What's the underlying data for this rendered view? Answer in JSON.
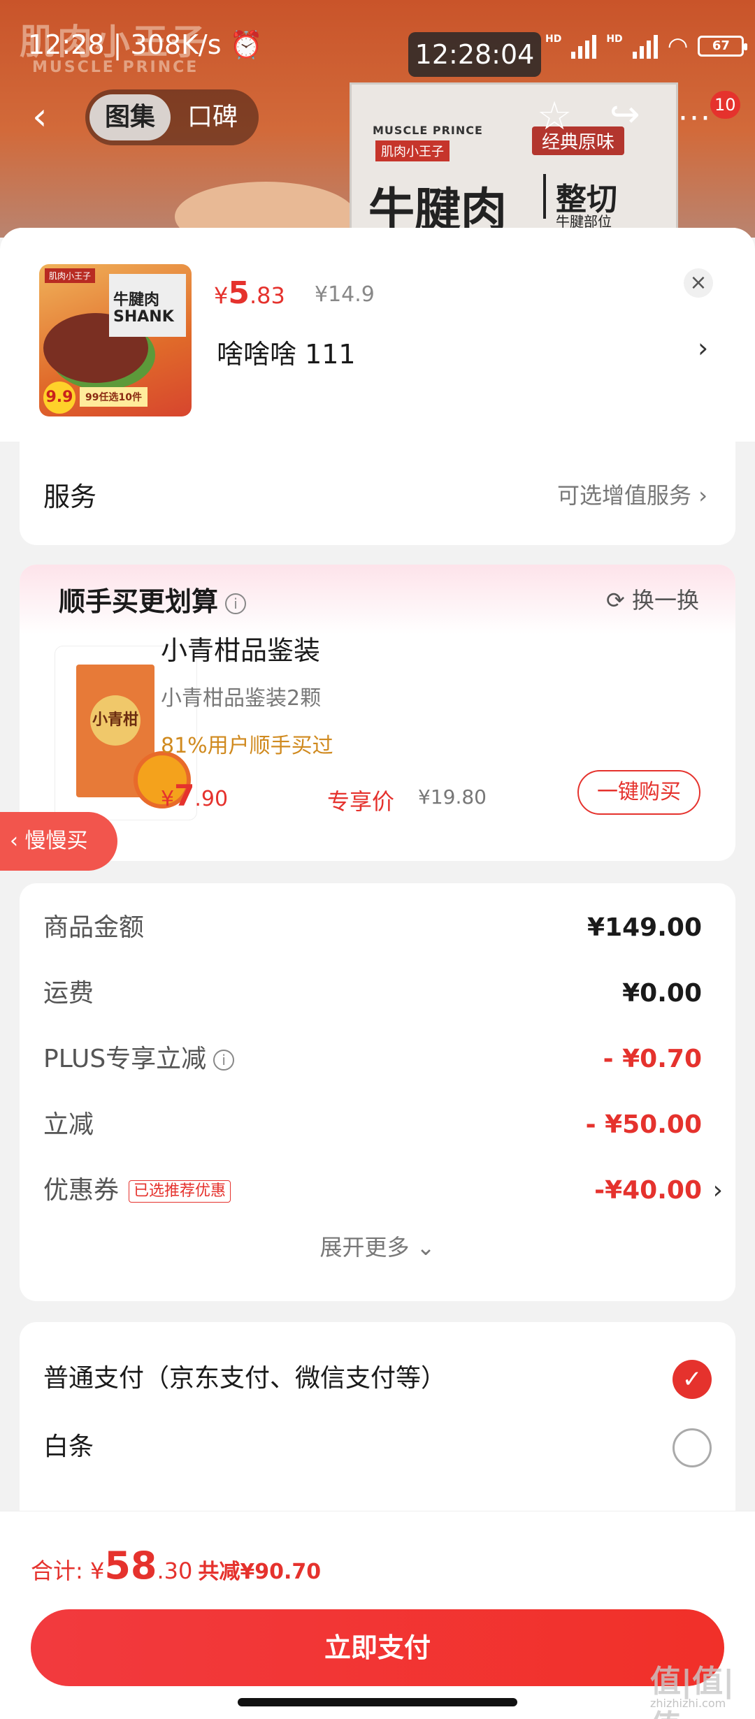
{
  "status": {
    "left_text": "12:28 | 308K/s ⏰",
    "center_time": "12:28:04",
    "hd1": "HD",
    "hd2": "HD",
    "battery": "67"
  },
  "background": {
    "brand_cn": "肌肉小王子",
    "brand_en": "MUSCLE PRINCE",
    "pack_brand": "MUSCLE PRINCE",
    "pack_brand_cn": "肌肉小王子",
    "pack_tag": "经典原味",
    "pack_main": "牛腱肉",
    "pack_cut": "整切",
    "pack_sub": "牛腱部位"
  },
  "nav": {
    "back": "‹",
    "tab_gallery": "图集",
    "tab_reviews": "口碑",
    "star": "☆",
    "share": "↪",
    "more": "···",
    "badge": "10"
  },
  "product": {
    "thumb_brand": "肌肉小王子",
    "thumb_pack": "牛腱肉 SHANK",
    "thumb_price": "9.9",
    "thumb_label": "99任选10件",
    "price_symbol": "¥",
    "price_int": "5",
    "price_dec": ".83",
    "orig_price": "¥14.9",
    "spec": "啥啥啥  111",
    "close": "×"
  },
  "service": {
    "title": "服务",
    "hint": "可选增值服务 ›"
  },
  "addon": {
    "title": "顺手买更划算",
    "info": "i",
    "swap": "⟳ 换一换",
    "img_label": "小青柑",
    "name": "小青柑品鉴装",
    "desc": "小青柑品鉴装2颗",
    "social": "81%用户顺手买过",
    "price_symbol": "¥",
    "price_int": "7",
    "price_dec": ".90",
    "exclusive": "专享价",
    "orig_price": "¥19.80",
    "buy_label": "一键购买"
  },
  "float_button": "‹ 慢慢买",
  "summary": {
    "rows": [
      {
        "label": "商品金额",
        "value": "¥149.00"
      },
      {
        "label": "运费",
        "value": "¥0.00"
      },
      {
        "label": "PLUS专享立减",
        "value": "- ¥0.70"
      },
      {
        "label": "立减",
        "value": "- ¥50.00"
      },
      {
        "label": "优惠券",
        "tag": "已选推荐优惠",
        "value": "-¥40.00"
      }
    ],
    "expand": "展开更多 ⌄"
  },
  "payment": {
    "options": [
      {
        "label": "普通支付（京东支付、微信支付等）",
        "selected": true
      },
      {
        "label": "白条",
        "selected": false
      }
    ]
  },
  "footer": {
    "total_label": "合计: ¥",
    "total_int": "58",
    "total_dec": ".30",
    "saved": "共减¥90.70",
    "pay_button": "立即支付"
  },
  "watermark": {
    "main": "值|值|值",
    "sub": "zhizhizhi.com"
  },
  "colors": {
    "accent": "#e5322d",
    "social_orange": "#d08a1f"
  }
}
